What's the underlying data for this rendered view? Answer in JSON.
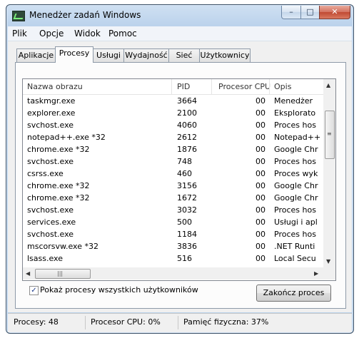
{
  "window": {
    "title": "Menedżer zadań Windows",
    "minimize_glyph": "–",
    "maximize_glyph": "□",
    "close_glyph": "✕",
    "icon": "task-manager-icon"
  },
  "menu": [
    "Plik",
    "Opcje",
    "Widok",
    "Pomoc"
  ],
  "tabs": [
    "Aplikacje",
    "Procesy",
    "Usługi",
    "Wydajność",
    "Sieć",
    "Użytkownicy"
  ],
  "active_tab": "Procesy",
  "table": {
    "columns": [
      "Nazwa obrazu",
      "PID",
      "Procesor CPU",
      "Opis"
    ],
    "rows": [
      [
        "taskmgr.exe",
        "3664",
        "00",
        "Menedżer"
      ],
      [
        "explorer.exe",
        "2100",
        "00",
        "Eksplorato"
      ],
      [
        "svchost.exe",
        "4060",
        "00",
        "Proces hos"
      ],
      [
        "notepad++.exe *32",
        "2612",
        "00",
        "Notepad++"
      ],
      [
        "chrome.exe *32",
        "1876",
        "00",
        "Google Chr"
      ],
      [
        "svchost.exe",
        "748",
        "00",
        "Proces hos"
      ],
      [
        "csrss.exe",
        "460",
        "00",
        "Proces wyk"
      ],
      [
        "chrome.exe *32",
        "3156",
        "00",
        "Google Chr"
      ],
      [
        "chrome.exe *32",
        "1672",
        "00",
        "Google Chr"
      ],
      [
        "svchost.exe",
        "3032",
        "00",
        "Proces hos"
      ],
      [
        "services.exe",
        "500",
        "00",
        "Usługi i apl"
      ],
      [
        "svchost.exe",
        "1184",
        "00",
        "Proces hos"
      ],
      [
        "mscorsvw.exe *32",
        "3836",
        "00",
        ".NET Runti"
      ],
      [
        "lsass.exe",
        "516",
        "00",
        "Local Secu"
      ]
    ]
  },
  "scroll": {
    "up": "▲",
    "down": "▼",
    "left": "◀",
    "right": "▶",
    "grip_v": "≡",
    "grip_h": "|||"
  },
  "show_all_checkbox": {
    "label": "Pokaż procesy wszystkich użytkowników",
    "checked": true,
    "mark": "✓"
  },
  "end_process_button": "Zakończ proces",
  "status": {
    "processes": "Procesy: 48",
    "cpu": "Procesor CPU: 0%",
    "memory": "Pamięć fizyczna: 37%"
  }
}
